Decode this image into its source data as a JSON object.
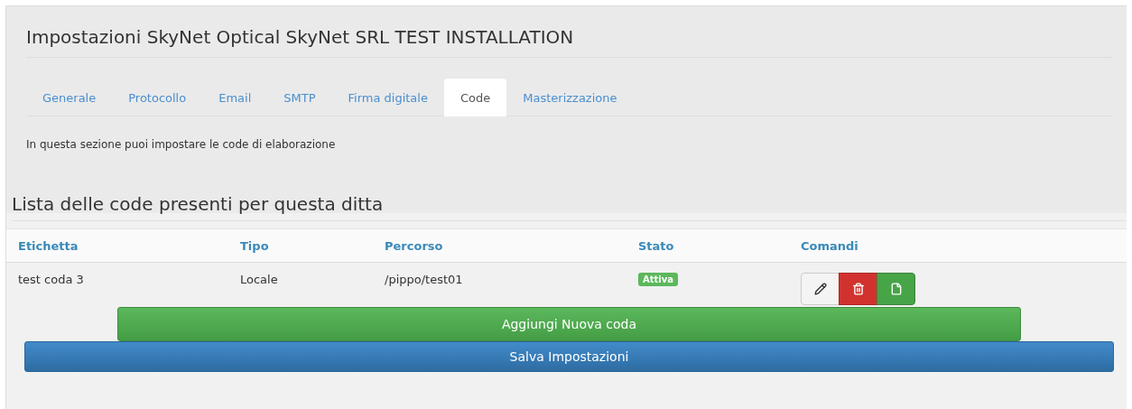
{
  "title": "Impostazioni SkyNet Optical SkyNet SRL TEST INSTALLATION",
  "tabs": [
    {
      "label": "Generale",
      "selected": false
    },
    {
      "label": "Protocollo",
      "selected": false
    },
    {
      "label": "Email",
      "selected": false
    },
    {
      "label": "SMTP",
      "selected": false
    },
    {
      "label": "Firma digitale",
      "selected": false
    },
    {
      "label": "Code",
      "selected": true
    },
    {
      "label": "Masterizzazione",
      "selected": false
    }
  ],
  "description": "In questa sezione puoi impostare le code di elaborazione",
  "list_heading": "Lista delle code presenti per questa ditta",
  "table": {
    "columns": [
      "Etichetta",
      "Tipo",
      "Percorso",
      "Stato",
      "Comandi"
    ],
    "rows": [
      {
        "label": "test coda 3",
        "type": "Locale",
        "path": "/pippo/test01",
        "status": "Attiva",
        "commands": [
          {
            "kind": "edit"
          },
          {
            "kind": "delete"
          },
          {
            "kind": "file"
          }
        ]
      }
    ]
  },
  "buttons": [
    {
      "kind": "add",
      "label": "Aggiungi Nuova coda"
    },
    {
      "kind": "save",
      "label": "Salva Impostazioni"
    }
  ]
}
